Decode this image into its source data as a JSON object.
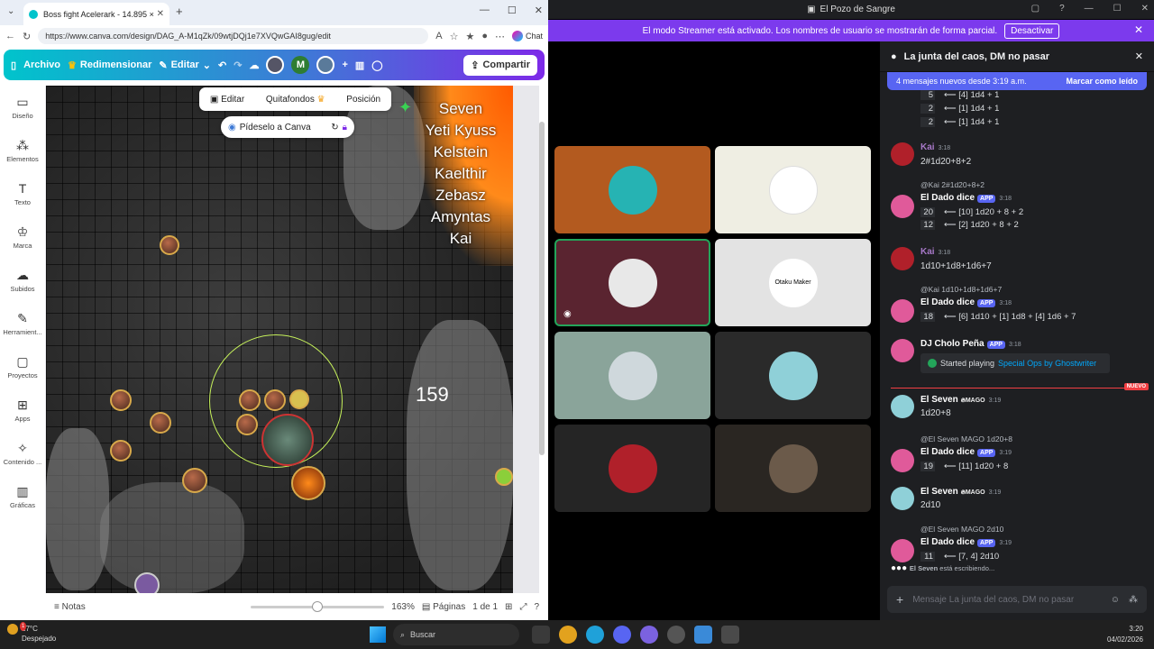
{
  "canva": {
    "tab_title": "Boss fight Acelerark - 14.895 × 1",
    "url": "https://www.canva.com/design/DAG_A-M1qZk/09wtjDQj1e7XVQwGAI8gug/edit",
    "chat_label": "Chat",
    "toolbar": {
      "archivo": "Archivo",
      "redimensionar": "Redimensionar",
      "editar": "Editar",
      "avatar_letter": "M",
      "compartir": "Compartir"
    },
    "sidebar": [
      {
        "label": "Diseño",
        "icon": "layout-icon"
      },
      {
        "label": "Elementos",
        "icon": "elements-icon"
      },
      {
        "label": "Texto",
        "icon": "text-icon"
      },
      {
        "label": "Marca",
        "icon": "brand-icon"
      },
      {
        "label": "Subidos",
        "icon": "upload-icon"
      },
      {
        "label": "Herramient...",
        "icon": "tools-icon"
      },
      {
        "label": "Proyectos",
        "icon": "folder-icon"
      },
      {
        "label": "Apps",
        "icon": "apps-icon"
      },
      {
        "label": "Contenido ...",
        "icon": "content-icon"
      },
      {
        "label": "Gráficas",
        "icon": "charts-icon"
      }
    ],
    "context_bar": {
      "editar": "Editar",
      "quitafondos": "Quitafondos",
      "posicion": "Posición"
    },
    "ask_canva": "Pídeselo a Canva",
    "player_names": [
      "Seven",
      "Yeti Kyuss",
      "Kelstein",
      "Kaelthir",
      "Zebasz",
      "Amyntas",
      "Kai"
    ],
    "map_number": "159",
    "bottom": {
      "notas": "Notas",
      "zoom": "163%",
      "paginas": "Páginas",
      "page_of": "1 de 1",
      "zoom_fraction": 0.46
    }
  },
  "discord": {
    "window_title": "El Pozo de Sangre",
    "streamer_text": "El modo Streamer está activado. Los nombres de usuario se mostrarán de forma parcial.",
    "streamer_button": "Desactivar",
    "channel": "La junta del caos, DM no pasar",
    "new_messages": "4 mensajes nuevos desde 3:19 a.m.",
    "mark_read": "Marcar como leído",
    "top_rolls": [
      {
        "n": "5",
        "t": "⟵ [4] 1d4 + 1"
      },
      {
        "n": "2",
        "t": "⟵ [1] 1d4 + 1"
      },
      {
        "n": "2",
        "t": "⟵ [1] 1d4 + 1"
      }
    ],
    "messages": {
      "m1": {
        "user": "Kai",
        "time": "3:18",
        "text": "2#1d20+8+2"
      },
      "m2": {
        "reply": "@Kai 2#1d20+8+2",
        "user": "El Dado dice",
        "badge": "APP",
        "time": "3:18",
        "rolls": [
          {
            "n": "20",
            "t": "⟵ [10] 1d20 + 8 + 2"
          },
          {
            "n": "12",
            "t": "⟵ [2] 1d20 + 8 + 2"
          }
        ]
      },
      "m3": {
        "user": "Kai",
        "time": "3:18",
        "text": "1d10+1d8+1d6+7"
      },
      "m4": {
        "reply": "@Kai 1d10+1d8+1d6+7",
        "user": "El Dado dice",
        "badge": "APP",
        "time": "3:18",
        "rolls": [
          {
            "n": "18",
            "t": "⟵ [6] 1d10 + [1] 1d8 + [4] 1d6 + 7"
          }
        ]
      },
      "m5": {
        "user": "DJ Cholo Peña",
        "badge": "APP",
        "time": "3:18",
        "embed_prefix": "Started playing",
        "embed_link": "Special Ops by Ghostwriter"
      },
      "new_label": "NUEVO",
      "m6": {
        "user": "El Seven",
        "role": "MAGO",
        "time": "3:19",
        "text": "1d20+8"
      },
      "m7": {
        "reply_user": "@El Seven",
        "reply_role": "MAGO",
        "reply_text": "1d20+8",
        "user": "El Dado dice",
        "badge": "APP",
        "time": "3:19",
        "rolls": [
          {
            "n": "19",
            "t": "⟵ [11] 1d20 + 8"
          }
        ]
      },
      "m8": {
        "user": "El Seven",
        "role": "MAGO",
        "time": "3:19",
        "text": "2d10"
      },
      "m9": {
        "reply_user": "@El Seven",
        "reply_role": "MAGO",
        "reply_text": "2d10",
        "user": "El Dado dice",
        "badge": "APP",
        "time": "3:19",
        "rolls": [
          {
            "n": "11",
            "t": "⟵ [7, 4] 2d10"
          }
        ]
      }
    },
    "typing_user": "El Seven",
    "typing_text": "está escribiendo...",
    "composer_placeholder": "Mensaje La junta del caos, DM no pasar",
    "tiles": [
      {
        "name": "bear-avatar-tile",
        "bg": "#b35a1f",
        "circle": "#26b3b3"
      },
      {
        "name": "reindeer-avatar-tile",
        "bg": "#efeee3",
        "circle": "#ffffff"
      },
      {
        "name": "santa-hat-avatar-tile",
        "bg": "#5a2430",
        "circle": "#e8e8e8"
      },
      {
        "name": "otaku-maker-avatar-tile",
        "bg": "#e3e3e3",
        "circle": "#ffffff"
      },
      {
        "name": "cat-avatar-tile",
        "bg": "#8aa49a",
        "circle": "#cfd8dc"
      },
      {
        "name": "cartoon-boy-avatar-tile",
        "bg": "#2a2a2a",
        "circle": "#8fd0d8"
      },
      {
        "name": "dark-hair-avatar-tile",
        "bg": "#252525",
        "circle": "#b0202a"
      },
      {
        "name": "witch-avatar-tile",
        "bg": "#2a2622",
        "circle": "#6b5a4a"
      }
    ],
    "otaku_label": "Otaku Maker"
  },
  "taskbar": {
    "temp": "17°C",
    "weather": "Despejado",
    "weather_badge": "1",
    "search": "Buscar",
    "time": "3:20",
    "date": "04/02/2026"
  }
}
